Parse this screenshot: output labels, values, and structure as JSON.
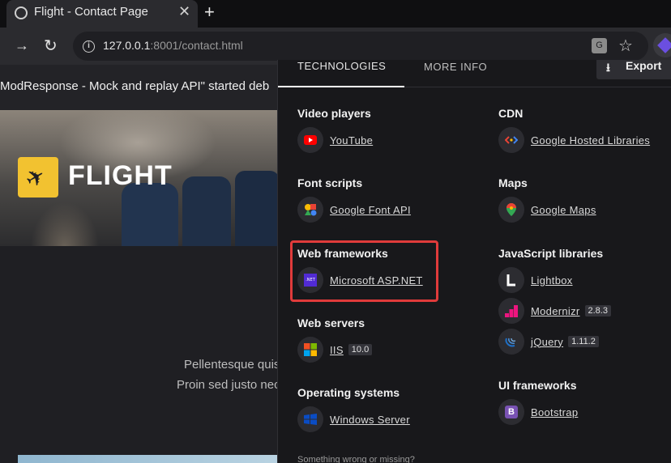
{
  "browser": {
    "tab_title": "Flight - Contact Page",
    "tab_close": "✕",
    "new_tab": "+",
    "url_host": "127.0.0.1",
    "url_rest": ":8001/contact.html"
  },
  "page": {
    "infobar_text": "ModResponse - Mock and replay API\" started deb",
    "logo_text": "FLIGHT",
    "lorem_line1": "Pellentesque quis",
    "lorem_line2": "Proin sed justo nec"
  },
  "popup": {
    "tabs": [
      "TECHNOLOGIES",
      "MORE INFO"
    ],
    "export_label": "Export",
    "footer": "Something wrong or missing?",
    "categories": {
      "video_players": {
        "title": "Video players",
        "items": [
          {
            "name": "YouTube",
            "icon": "youtube-icon"
          }
        ]
      },
      "font_scripts": {
        "title": "Font scripts",
        "items": [
          {
            "name": "Google Font API",
            "icon": "google-fonts-icon"
          }
        ]
      },
      "web_frameworks": {
        "title": "Web frameworks",
        "items": [
          {
            "name": "Microsoft ASP.NET",
            "icon": "dotnet-icon",
            "icon_text": ".NET"
          }
        ]
      },
      "web_servers": {
        "title": "Web servers",
        "items": [
          {
            "name": "IIS",
            "version": "10.0",
            "icon": "windows-logo-icon"
          }
        ]
      },
      "operating_systems": {
        "title": "Operating systems",
        "items": [
          {
            "name": "Windows Server",
            "icon": "windows-server-icon"
          }
        ]
      },
      "cdn": {
        "title": "CDN",
        "items": [
          {
            "name": "Google Hosted Libraries",
            "icon": "google-hosted-libraries-icon"
          }
        ]
      },
      "maps": {
        "title": "Maps",
        "items": [
          {
            "name": "Google Maps",
            "icon": "google-maps-icon"
          }
        ]
      },
      "js_libraries": {
        "title": "JavaScript libraries",
        "items": [
          {
            "name": "Lightbox",
            "icon": "lightbox-icon"
          },
          {
            "name": "Modernizr",
            "version": "2.8.3",
            "icon": "modernizr-icon"
          },
          {
            "name": "jQuery",
            "version": "1.11.2",
            "icon": "jquery-icon"
          }
        ]
      },
      "ui_frameworks": {
        "title": "UI frameworks",
        "items": [
          {
            "name": "Bootstrap",
            "icon": "bootstrap-icon",
            "icon_text": "B"
          }
        ]
      }
    }
  },
  "colors": {
    "highlight": "#e03b3b",
    "logo_yellow": "#f2c230",
    "dotnet_purple": "#512bd4",
    "bootstrap_purple": "#7952b3"
  }
}
